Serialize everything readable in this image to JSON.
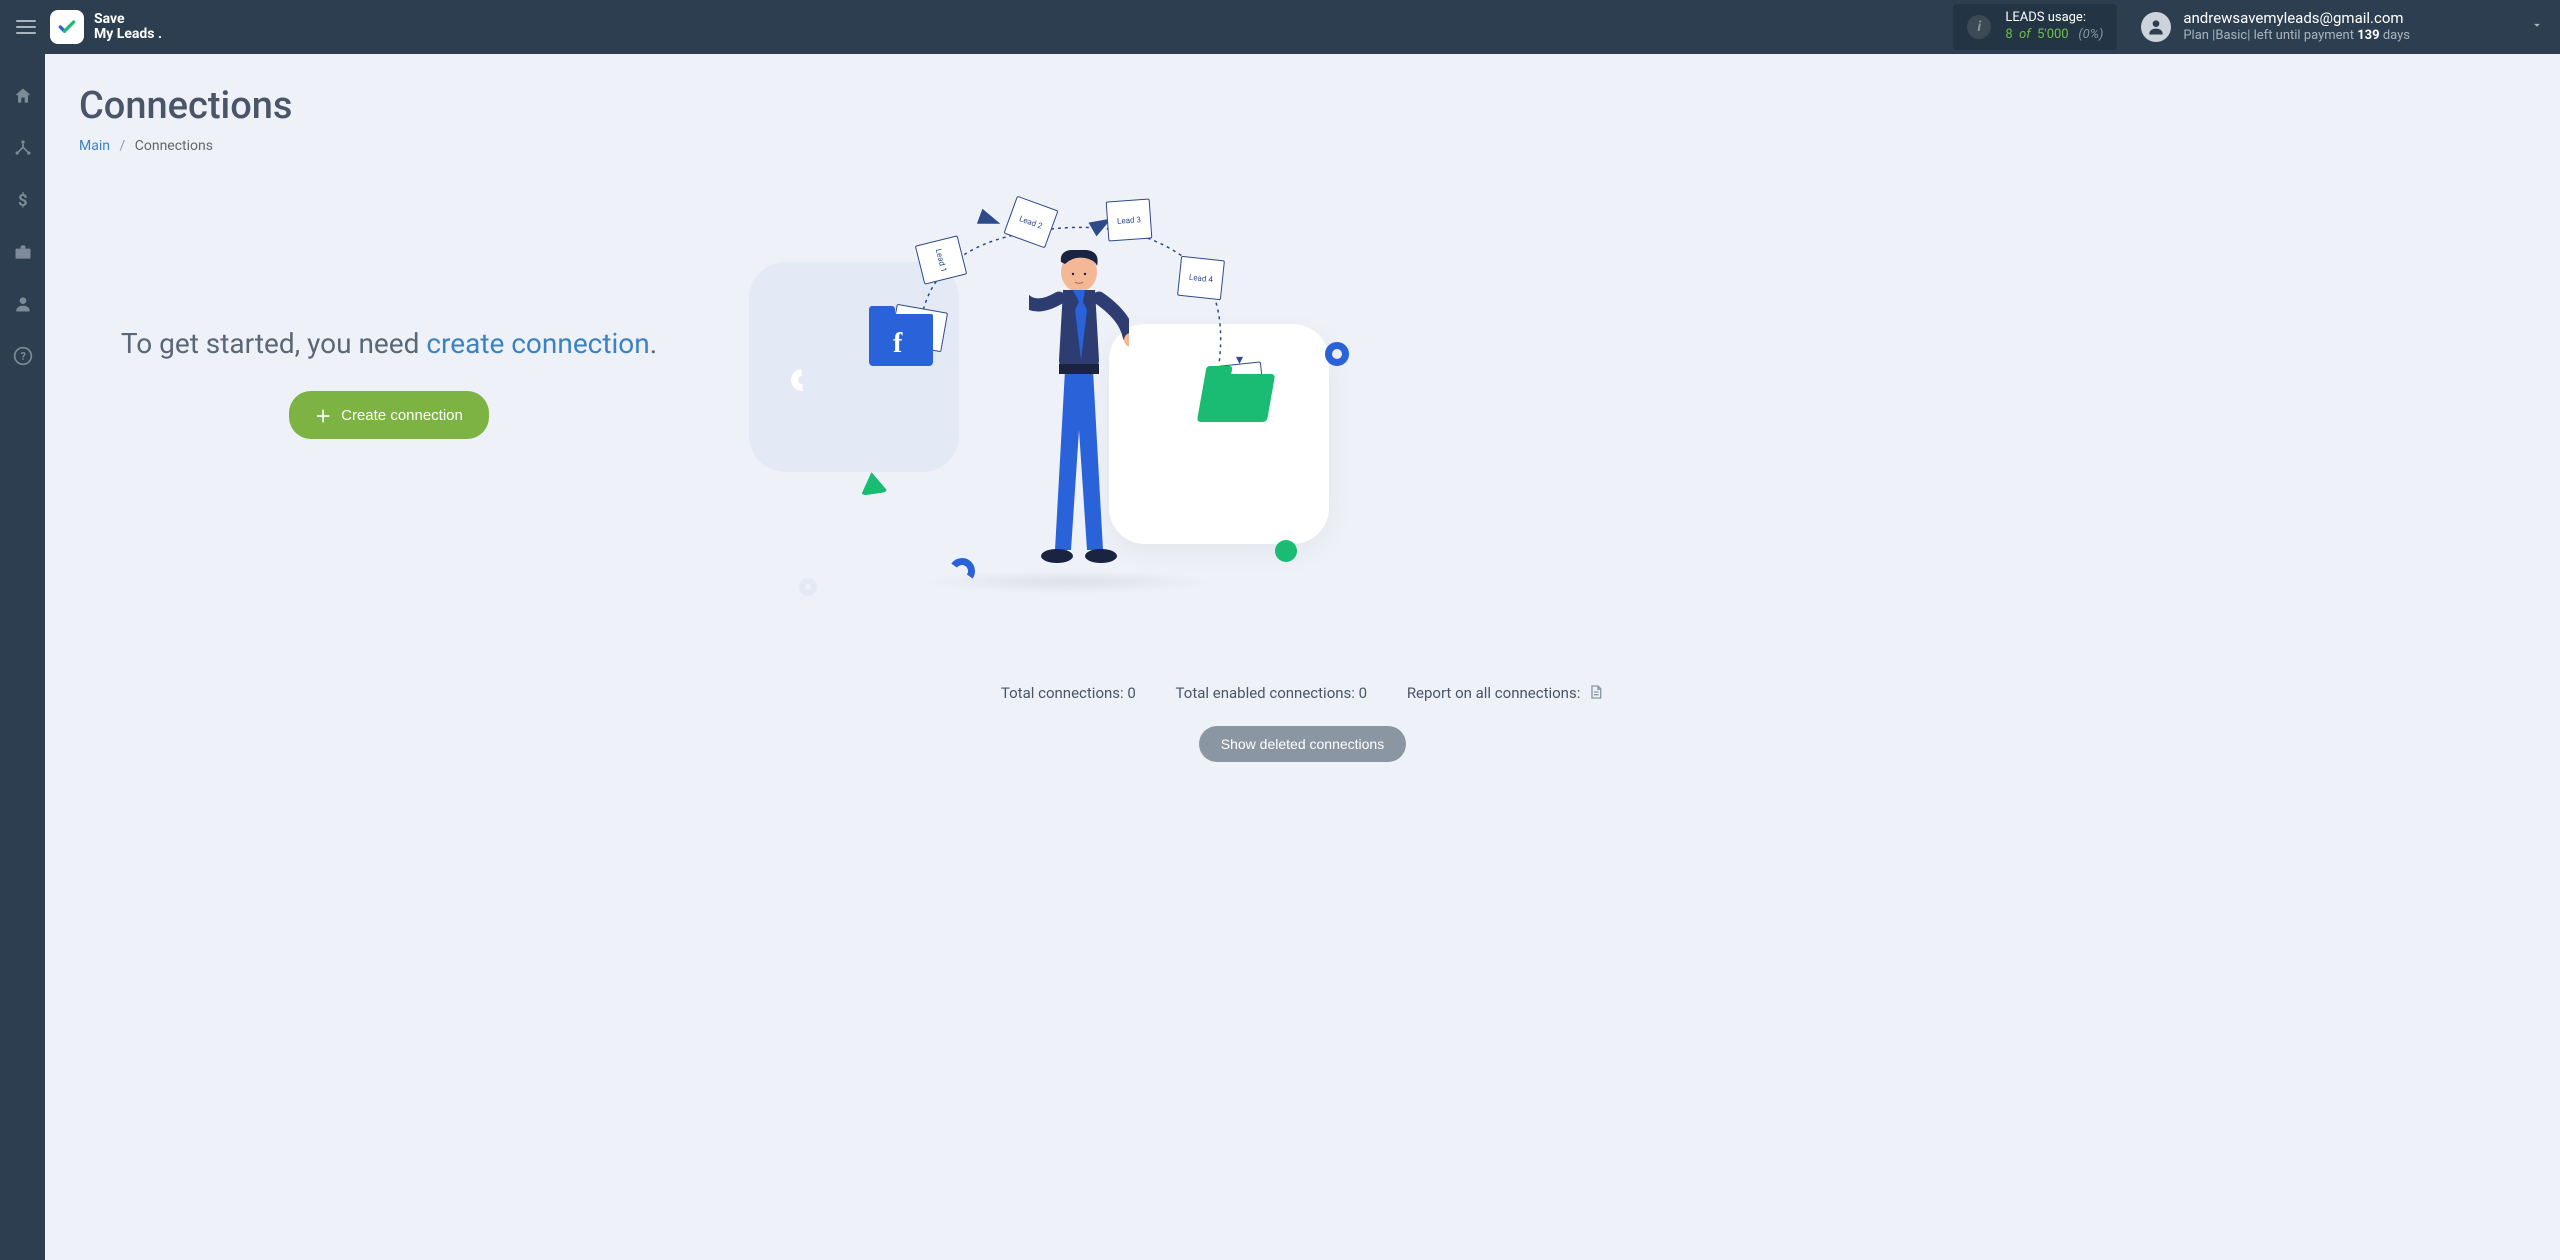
{
  "logo": {
    "line1": "Save",
    "line2": "My Leads"
  },
  "usage": {
    "label": "LEADS usage:",
    "current": "8",
    "of_label": "of",
    "total": "5'000",
    "percent": "(0%)"
  },
  "account": {
    "email": "andrewsavemyleads@gmail.com",
    "plan_prefix": "Plan |",
    "plan_name": "Basic",
    "plan_mid": "| left until payment ",
    "days": "139",
    "days_unit": " days"
  },
  "page": {
    "title": "Connections",
    "breadcrumb_root": "Main",
    "breadcrumb_current": "Connections"
  },
  "empty": {
    "msg_prefix": "To get started, you need ",
    "msg_link": "create connection",
    "msg_suffix": ".",
    "create_btn": "Create connection"
  },
  "illustration": {
    "lead1": "Lead 1",
    "lead2": "Lead 2",
    "lead3": "Lead 3",
    "lead4": "Lead 4",
    "fb_letter": "f"
  },
  "stats": {
    "total_label": "Total connections: ",
    "total_value": "0",
    "enabled_label": "Total enabled connections: ",
    "enabled_value": "0",
    "report_label": "Report on all connections:"
  },
  "deleted_btn": "Show deleted connections"
}
